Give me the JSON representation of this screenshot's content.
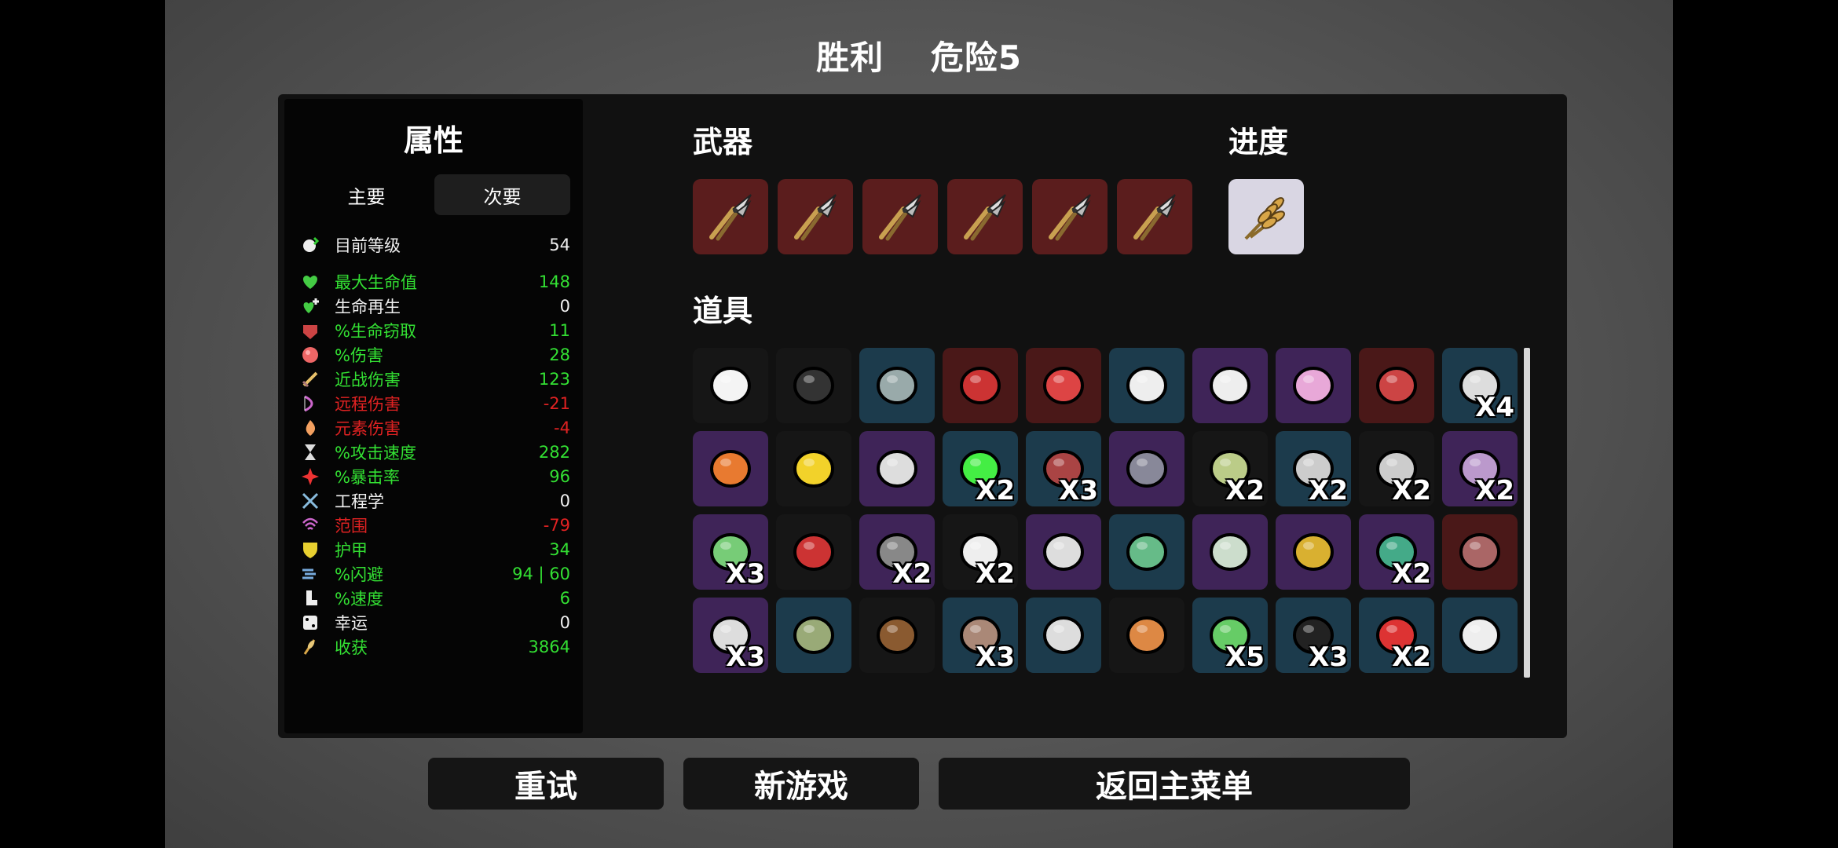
{
  "header": {
    "result": "胜利",
    "danger": "危险5"
  },
  "attributes": {
    "title": "属性",
    "tabs": {
      "primary": "主要",
      "secondary": "次要"
    },
    "stats": [
      {
        "icon": "level-icon",
        "label": "目前等级",
        "value": "54",
        "color": "white"
      },
      {
        "icon": "heart-icon",
        "label": "最大生命值",
        "value": "148",
        "color": "green"
      },
      {
        "icon": "regen-icon",
        "label": "生命再生",
        "value": "0",
        "color": "white"
      },
      {
        "icon": "lifesteal-icon",
        "label": "%生命窃取",
        "value": "11",
        "color": "green"
      },
      {
        "icon": "damage-icon",
        "label": "%伤害",
        "value": "28",
        "color": "green"
      },
      {
        "icon": "sword-icon",
        "label": "近战伤害",
        "value": "123",
        "color": "green"
      },
      {
        "icon": "bow-icon",
        "label": "远程伤害",
        "value": "-21",
        "color": "red"
      },
      {
        "icon": "flame-icon",
        "label": "元素伤害",
        "value": "-4",
        "color": "red"
      },
      {
        "icon": "hourglass-icon",
        "label": "%攻击速度",
        "value": "282",
        "color": "green"
      },
      {
        "icon": "crit-icon",
        "label": "%暴击率",
        "value": "96",
        "color": "green"
      },
      {
        "icon": "wrench-icon",
        "label": "工程学",
        "value": "0",
        "color": "white"
      },
      {
        "icon": "range-icon",
        "label": "范围",
        "value": "-79",
        "color": "red"
      },
      {
        "icon": "shield-icon",
        "label": "护甲",
        "value": "34",
        "color": "green"
      },
      {
        "icon": "dodge-icon",
        "label": "%闪避",
        "value": "94 | 60",
        "color": "green"
      },
      {
        "icon": "boot-icon",
        "label": "%速度",
        "value": "6",
        "color": "green"
      },
      {
        "icon": "dice-icon",
        "label": "幸运",
        "value": "0",
        "color": "white"
      },
      {
        "icon": "harvest-icon",
        "label": "收获",
        "value": "3864",
        "color": "green"
      }
    ]
  },
  "weapons": {
    "title": "武器",
    "list": [
      "pruner-icon",
      "pruner-icon",
      "pruner-icon",
      "pruner-icon",
      "pruner-icon",
      "pruner-icon"
    ]
  },
  "progress": {
    "title": "进度",
    "icon": "wheat-icon"
  },
  "items": {
    "title": "道具",
    "list": [
      {
        "icon": "egg-face-icon",
        "tier": "black",
        "count": ""
      },
      {
        "icon": "coal-icon",
        "tier": "black",
        "count": ""
      },
      {
        "icon": "bullet-icon",
        "tier": "blue",
        "count": ""
      },
      {
        "icon": "hoodie-icon",
        "tier": "red",
        "count": ""
      },
      {
        "icon": "cape-icon",
        "tier": "red",
        "count": ""
      },
      {
        "icon": "worm-icon",
        "tier": "blue",
        "count": ""
      },
      {
        "icon": "wings-icon",
        "tier": "purple",
        "count": ""
      },
      {
        "icon": "brain-icon",
        "tier": "purple",
        "count": ""
      },
      {
        "icon": "stomach-icon",
        "tier": "red",
        "count": ""
      },
      {
        "icon": "claw-icon",
        "tier": "blue",
        "count": "X4"
      },
      {
        "icon": "robot-icon",
        "tier": "purple",
        "count": ""
      },
      {
        "icon": "duck-icon",
        "tier": "black",
        "count": ""
      },
      {
        "icon": "tardigrade-icon",
        "tier": "purple",
        "count": ""
      },
      {
        "icon": "potion-icon",
        "tier": "blue",
        "count": "X2"
      },
      {
        "icon": "tentacle-icon",
        "tier": "blue",
        "count": "X3"
      },
      {
        "icon": "jar-icon",
        "tier": "purple",
        "count": ""
      },
      {
        "icon": "soldier-icon",
        "tier": "black",
        "count": "X2"
      },
      {
        "icon": "bird-icon",
        "tier": "blue",
        "count": "X2"
      },
      {
        "icon": "spider-icon",
        "tier": "black",
        "count": "X2"
      },
      {
        "icon": "demon-icon",
        "tier": "purple",
        "count": "X2"
      },
      {
        "icon": "tractor-icon",
        "tier": "purple",
        "count": "X3"
      },
      {
        "icon": "snake-icon",
        "tier": "black",
        "count": ""
      },
      {
        "icon": "turret-icon",
        "tier": "purple",
        "count": "X2"
      },
      {
        "icon": "fang-icon",
        "tier": "black",
        "count": "X2"
      },
      {
        "icon": "rat-icon",
        "tier": "purple",
        "count": ""
      },
      {
        "icon": "grinder-icon",
        "tier": "blue",
        "count": ""
      },
      {
        "icon": "mummy-icon",
        "tier": "purple",
        "count": ""
      },
      {
        "icon": "crown-icon",
        "tier": "purple",
        "count": ""
      },
      {
        "icon": "peacock-icon",
        "tier": "purple",
        "count": "X2"
      },
      {
        "icon": "mammoth-icon",
        "tier": "red",
        "count": ""
      },
      {
        "icon": "rocket-icon",
        "tier": "purple",
        "count": "X3"
      },
      {
        "icon": "garden-icon",
        "tier": "blue",
        "count": ""
      },
      {
        "icon": "poop-icon",
        "tier": "black",
        "count": ""
      },
      {
        "icon": "wheelbarrow-icon",
        "tier": "blue",
        "count": "X3"
      },
      {
        "icon": "blade-icon",
        "tier": "blue",
        "count": ""
      },
      {
        "icon": "cap-icon",
        "tier": "black",
        "count": ""
      },
      {
        "icon": "frog-icon",
        "tier": "blue",
        "count": "X5"
      },
      {
        "icon": "glasses-icon",
        "tier": "blue",
        "count": "X3"
      },
      {
        "icon": "lifebuoy-icon",
        "tier": "blue",
        "count": "X2"
      },
      {
        "icon": "flag-icon",
        "tier": "blue",
        "count": ""
      }
    ]
  },
  "buttons": {
    "retry": "重试",
    "new_game": "新游戏",
    "main_menu": "返回主菜单"
  },
  "colors": {
    "green": "#33e033",
    "red": "#e02222",
    "white": "#f0f0f0"
  }
}
